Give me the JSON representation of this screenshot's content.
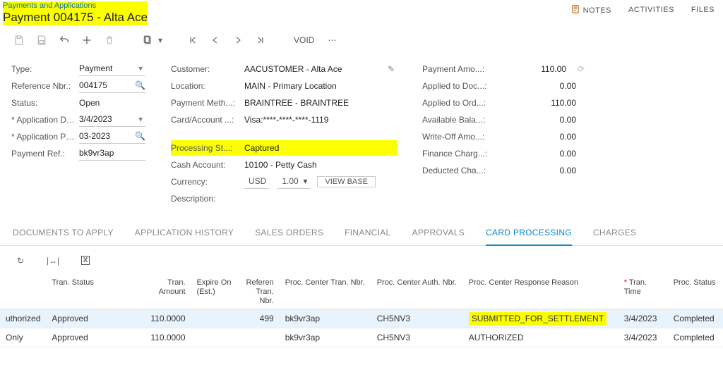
{
  "header": {
    "breadcrumb": "Payments and Applications",
    "title": "Payment 004175 - Alta Ace",
    "links": {
      "notes": "NOTES",
      "activities": "ACTIVITIES",
      "files": "FILES"
    }
  },
  "toolbar": {
    "void": "VOID"
  },
  "form": {
    "left": {
      "type_label": "Type:",
      "type": "Payment",
      "ref_label": "Reference Nbr.:",
      "ref": "004175",
      "status_label": "Status:",
      "status": "Open",
      "appdate_label": "* Application Date:",
      "appdate": "3/4/2023",
      "apppe_label": "* Application Pe...:",
      "apppe": "03-2023",
      "payref_label": "Payment Ref.:",
      "payref": "bk9vr3ap"
    },
    "mid": {
      "cust_label": "Customer:",
      "cust": "AACUSTOMER - Alta Ace",
      "loc_label": "Location:",
      "loc": "MAIN - Primary Location",
      "pm_label": "Payment Meth...:",
      "pm": "BRAINTREE - BRAINTREE",
      "card_label": "Card/Account ...:",
      "card": "Visa:****-****-****-1119",
      "ps_label": "Processing St...:",
      "ps": "Captured",
      "cash_label": "Cash Account:",
      "cash": "10100 - Petty Cash",
      "cur_label": "Currency:",
      "cur": "USD",
      "rate": "1.00",
      "viewbase": "VIEW BASE",
      "desc_label": "Description:"
    },
    "right": {
      "amt_label": "Payment Amo...:",
      "amt": "110.00",
      "appdoc_label": "Applied to Doc...:",
      "appdoc": "0.00",
      "appord_label": "Applied to Ord...:",
      "appord": "110.00",
      "avail_label": "Available Bala...:",
      "avail": "0.00",
      "wo_label": "Write-Off Amo...:",
      "wo": "0.00",
      "fin_label": "Finance Charg...:",
      "fin": "0.00",
      "ded_label": "Deducted Cha...:",
      "ded": "0.00"
    }
  },
  "tabs": {
    "t0": "DOCUMENTS TO APPLY",
    "t1": "APPLICATION HISTORY",
    "t2": "SALES ORDERS",
    "t3": "FINANCIAL",
    "t4": "APPROVALS",
    "t5": "CARD PROCESSING",
    "t6": "CHARGES"
  },
  "grid": {
    "cols": {
      "c0": "",
      "c1": "Tran. Status",
      "c2": "Tran.\nAmount",
      "c3": "Expire On\n(Est.)",
      "c4": "Referen\nTran.\nNbr.",
      "c5": "Proc. Center Tran. Nbr.",
      "c6": "Proc. Center Auth. Nbr.",
      "c7": "Proc. Center Response Reason",
      "c8": "Tran.\nTime",
      "c9": "Proc. Status"
    },
    "rows": [
      {
        "c0": "uthorized",
        "c1": "Approved",
        "c2": "110.0000",
        "c3": "",
        "c4": "499",
        "c5": "bk9vr3ap",
        "c6": "CH5NV3",
        "c7": "SUBMITTED_FOR_SETTLEMENT",
        "c8": "3/4/2023",
        "c9": "Completed",
        "hl": true,
        "sel": true
      },
      {
        "c0": "Only",
        "c1": "Approved",
        "c2": "110.0000",
        "c3": "",
        "c4": "",
        "c5": "bk9vr3ap",
        "c6": "CH5NV3",
        "c7": "AUTHORIZED",
        "c8": "3/4/2023",
        "c9": "Completed",
        "hl": false,
        "sel": false
      }
    ]
  }
}
